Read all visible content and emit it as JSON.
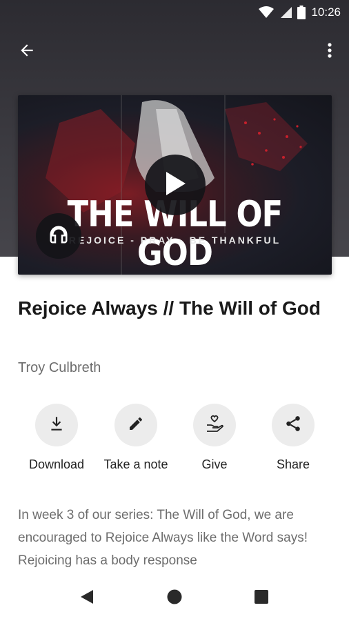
{
  "status_bar": {
    "time": "10:26",
    "icons": [
      "wifi-icon",
      "signal-icon",
      "battery-icon"
    ]
  },
  "top_bar": {
    "back_icon": "arrow-back-icon",
    "menu_icon": "more-vertical-icon"
  },
  "media": {
    "thumbnail_title": "THE WILL OF GOD",
    "thumbnail_subtitle": "REJOICE - PRAY - BE THANKFUL",
    "play_icon": "play-icon",
    "audio_icon": "headphones-icon"
  },
  "sermon": {
    "title": "Rejoice Always // The Will of God",
    "speaker": "Troy Culbreth",
    "description": "In week 3 of our series: The Will of God, we are encouraged to Rejoice Always like the Word says!  Rejoicing has a body response"
  },
  "actions": [
    {
      "label": "Download",
      "icon": "download-icon"
    },
    {
      "label": "Take a note",
      "icon": "pencil-icon"
    },
    {
      "label": "Give",
      "icon": "hand-heart-icon"
    },
    {
      "label": "Share",
      "icon": "share-icon"
    }
  ],
  "nav_bar": {
    "icons": [
      "back-triangle-icon",
      "home-circle-icon",
      "recents-square-icon"
    ]
  },
  "colors": {
    "header_bg": "#3b3a40",
    "action_circle": "#ececec",
    "text_primary": "#1a1a1a",
    "text_secondary": "#6d6d6d"
  }
}
